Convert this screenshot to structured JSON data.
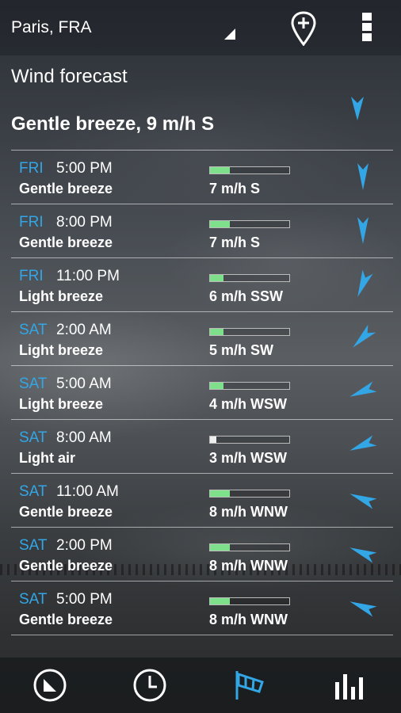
{
  "header": {
    "location": "Paris, FRA"
  },
  "title": "Wind forecast",
  "current": {
    "text": "Gentle breeze, 9 m/h S",
    "direction_icon": "wind-direction-arrow-icon"
  },
  "accent_color": "#33a6e6",
  "forecast": [
    {
      "day": "FRI",
      "time": "5:00 PM",
      "desc": "Gentle breeze",
      "speed": "7 m/h S",
      "level": 0.25
    },
    {
      "day": "FRI",
      "time": "8:00 PM",
      "desc": "Gentle breeze",
      "speed": "7 m/h S",
      "level": 0.25
    },
    {
      "day": "FRI",
      "time": "11:00 PM",
      "desc": "Light breeze",
      "speed": "6 m/h SSW",
      "level": 0.17
    },
    {
      "day": "SAT",
      "time": "2:00 AM",
      "desc": "Light breeze",
      "speed": "5 m/h SW",
      "level": 0.17
    },
    {
      "day": "SAT",
      "time": "5:00 AM",
      "desc": "Light breeze",
      "speed": "4 m/h WSW",
      "level": 0.17
    },
    {
      "day": "SAT",
      "time": "8:00 AM",
      "desc": "Light air",
      "speed": "3 m/h WSW",
      "level": 0.08
    },
    {
      "day": "SAT",
      "time": "11:00 AM",
      "desc": "Gentle breeze",
      "speed": "8 m/h WNW",
      "level": 0.25
    },
    {
      "day": "SAT",
      "time": "2:00 PM",
      "desc": "Gentle breeze",
      "speed": "8 m/h WNW",
      "level": 0.25
    },
    {
      "day": "SAT",
      "time": "5:00 PM",
      "desc": "Gentle breeze",
      "speed": "8 m/h WNW",
      "level": 0.25
    }
  ],
  "nav": [
    "clock-face-icon",
    "clock-icon",
    "windsock-icon",
    "bar-chart-icon"
  ]
}
